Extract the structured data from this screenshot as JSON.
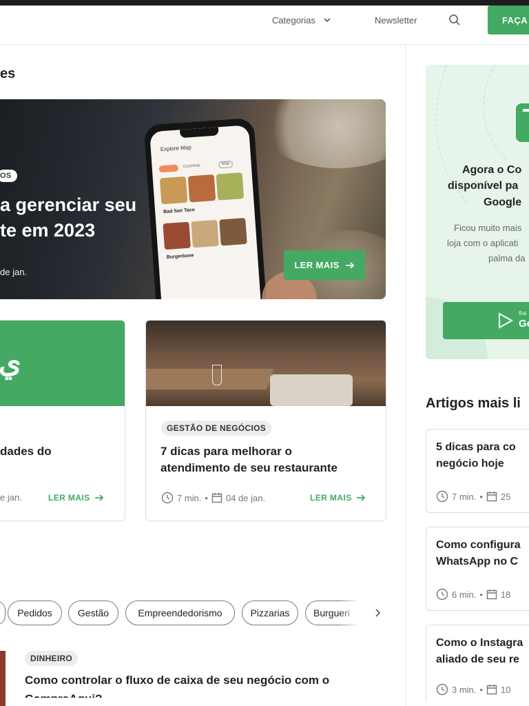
{
  "header": {
    "categories_label": "Categorias",
    "newsletter_label": "Newsletter",
    "cta_label": "FAÇA"
  },
  "main": {
    "section_title": "es",
    "hero": {
      "tag": "OS",
      "title_line1": "a gerenciar seu",
      "title_line2": "te em 2023",
      "date": "de jan.",
      "read_more": "LER MAIS",
      "phone": {
        "screen_title": "Explore Map",
        "chips": [
          "",
          "Cozinhas",
          "Map"
        ],
        "place_name": "Bad San Taco",
        "place_name2": "Burgerbone"
      }
    },
    "cards": [
      {
        "title_line1": "dades do",
        "date": "e jan.",
        "read_more": "LER MAIS",
        "logo_glyph": "ي"
      },
      {
        "tag": "GESTÃO DE NEGÓCIOS",
        "title_line1": "7 dicas para melhorar o",
        "title_line2": "atendimento de seu restaurante",
        "read_time": "7 min.",
        "date": "04 de jan.",
        "read_more": "LER MAIS"
      }
    ],
    "filters": [
      "Pedidos",
      "Gestão",
      "Empreendedorismo",
      "Pizzarias",
      "Burgueri"
    ],
    "list_item": {
      "tag": "DINHEIRO",
      "title": "Como controlar o fluxo de caixa de seu negócio com o",
      "title_overflow": "CompraAqui?"
    }
  },
  "sidebar": {
    "promo": {
      "line1": "Agora o Co",
      "line2": "disponível pa",
      "line3": "Google",
      "desc1": "Ficou muito mais",
      "desc2": "loja com o aplicati",
      "desc3": "palma da",
      "store_small": "Bai",
      "store_big": "Ge"
    },
    "popular_title": "Artigos mais li",
    "articles": [
      {
        "line1": "5 dicas para co",
        "line2": "negócio hoje",
        "read_time": "7 min.",
        "date": "25"
      },
      {
        "line1": "Como configura",
        "line2": "WhatsApp no C",
        "read_time": "6 min.",
        "date": "18"
      },
      {
        "line1": "Como o Instagra",
        "line2": "aliado de seu re",
        "read_time": "3 min.",
        "date": "10"
      }
    ]
  },
  "colors": {
    "accent": "#43a963",
    "chip_bg": "#ececec",
    "promo_bg": "#e6f4ea"
  }
}
